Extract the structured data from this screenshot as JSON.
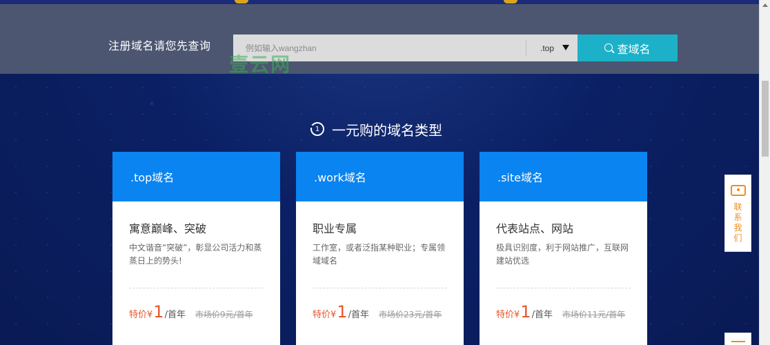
{
  "search": {
    "label": "注册域名请您先查询",
    "placeholder": "例如输入wangzhan",
    "tld_selected": ".top",
    "button_label": "查域名"
  },
  "watermark": "壹云网",
  "section": {
    "title": "一元购的域名类型",
    "icon_text": "1"
  },
  "cards": [
    {
      "name": ".top域名",
      "title": "寓意巅峰、突破",
      "desc": "中文谐音“突破”，彰显公司活力和蒸蒸日上的势头!",
      "price_label": "特价¥",
      "price": "1",
      "unit": "/首年",
      "market": "市场价9元/首年"
    },
    {
      "name": ".work域名",
      "title": "职业专属",
      "desc": "工作室，或者泛指某种职业；专属领域域名",
      "price_label": "特价¥",
      "price": "1",
      "unit": "/首年",
      "market": "市场价23元/首年"
    },
    {
      "name": ".site域名",
      "title": "代表站点、网站",
      "desc": "极具识别度，利于网站推广，互联网建站优选",
      "price_label": "特价¥",
      "price": "1",
      "unit": "/首年",
      "market": "市场价11元/首年"
    }
  ],
  "contact": {
    "label": "联系我们"
  },
  "colors": {
    "accent": "#1cb1c8",
    "card_header": "#0a84f0",
    "price": "#e8562a",
    "contact": "#f08c1e",
    "background": "#0a1f5c"
  }
}
